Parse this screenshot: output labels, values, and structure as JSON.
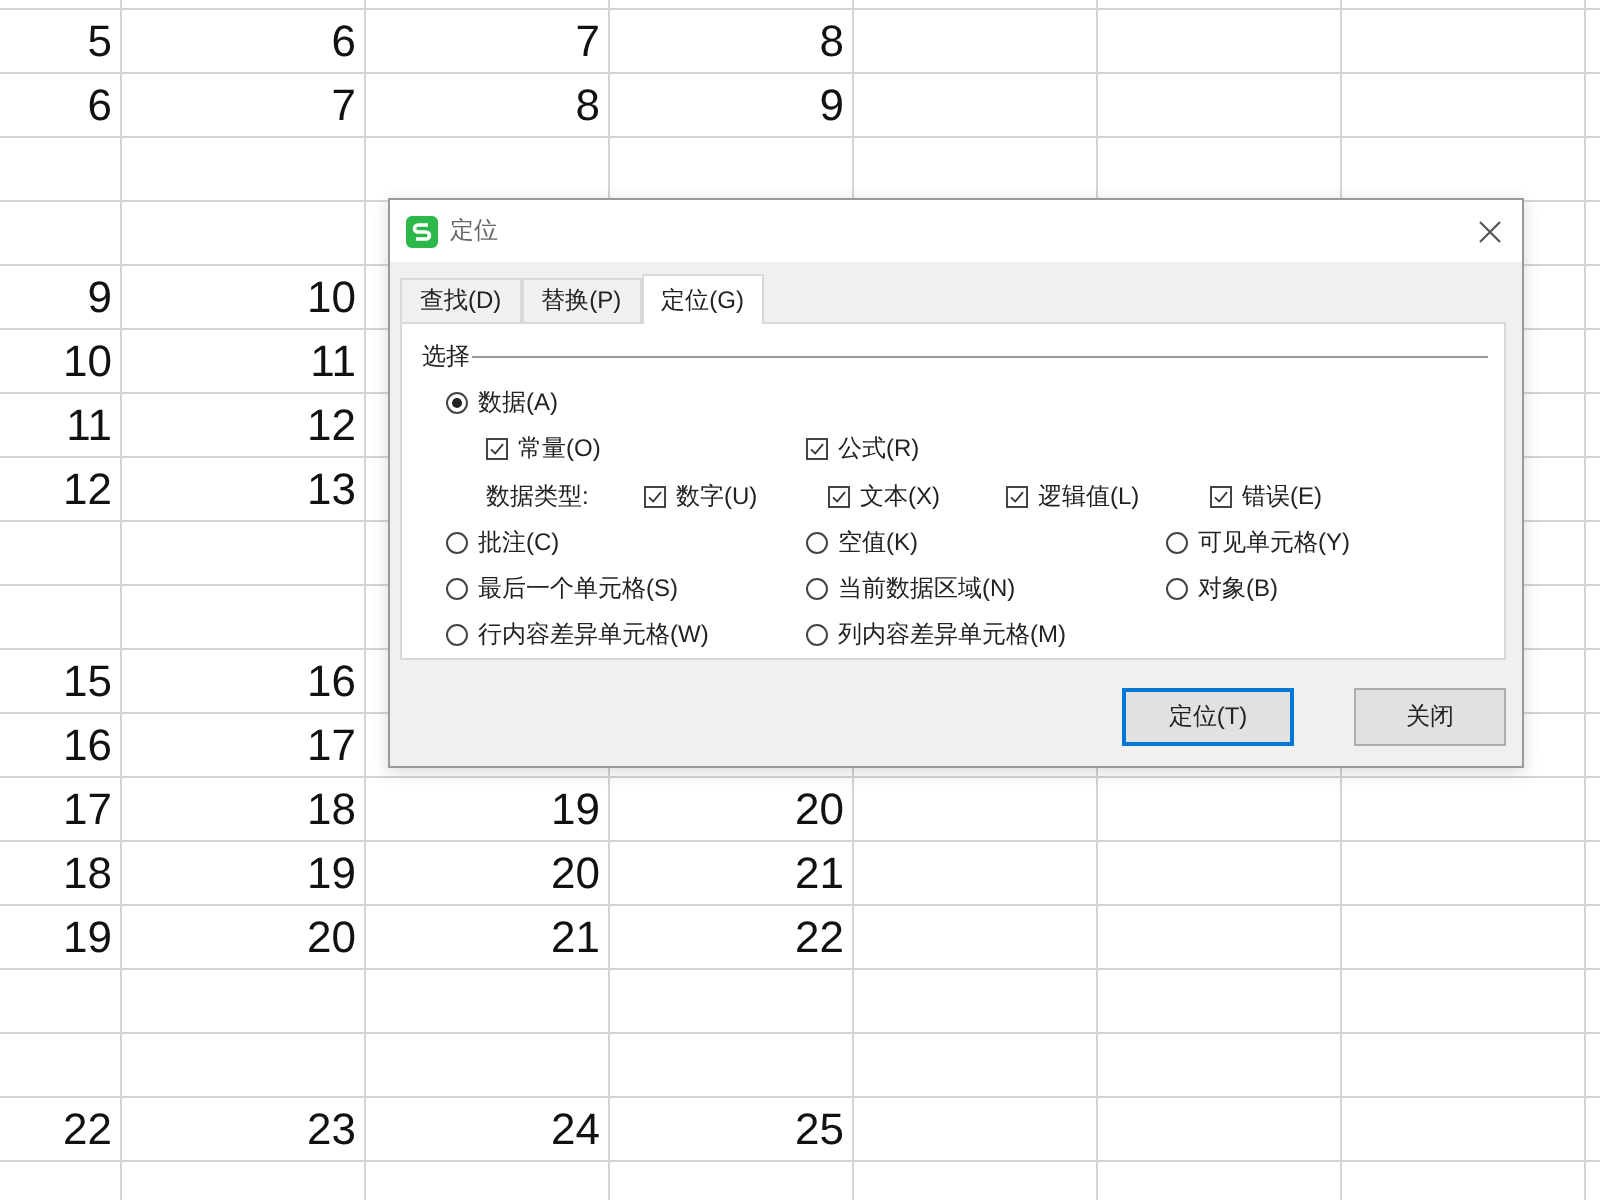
{
  "sheet": {
    "rows": [
      {
        "cells": [
          "5",
          "6",
          "7",
          "8"
        ]
      },
      {
        "cells": [
          "6",
          "7",
          "8",
          "9"
        ]
      },
      {
        "cells": []
      },
      {
        "cells": []
      },
      {
        "cells": [
          "9",
          "10"
        ]
      },
      {
        "cells": [
          "10",
          "11"
        ]
      },
      {
        "cells": [
          "11",
          "12"
        ]
      },
      {
        "cells": [
          "12",
          "13"
        ]
      },
      {
        "cells": []
      },
      {
        "cells": []
      },
      {
        "cells": [
          "15",
          "16"
        ]
      },
      {
        "cells": [
          "16",
          "17"
        ]
      },
      {
        "cells": [
          "17",
          "18",
          "19",
          "20"
        ]
      },
      {
        "cells": [
          "18",
          "19",
          "20",
          "21"
        ]
      },
      {
        "cells": [
          "19",
          "20",
          "21",
          "22"
        ]
      },
      {
        "cells": []
      },
      {
        "cells": []
      },
      {
        "cells": [
          "22",
          "23",
          "24",
          "25"
        ]
      },
      {
        "cells": []
      }
    ]
  },
  "dialog": {
    "title": "定位",
    "tabs": [
      {
        "label": "查找(D)",
        "selected": false
      },
      {
        "label": "替换(P)",
        "selected": false
      },
      {
        "label": "定位(G)",
        "selected": true
      }
    ],
    "group_label": "选择",
    "data_option": {
      "label": "数据(A)",
      "selected": true
    },
    "data_checks": [
      {
        "label": "常量(O)",
        "checked": true
      },
      {
        "label": "公式(R)",
        "checked": true
      }
    ],
    "data_type_label": "数据类型:",
    "data_types": [
      {
        "label": "数字(U)",
        "checked": true
      },
      {
        "label": "文本(X)",
        "checked": true
      },
      {
        "label": "逻辑值(L)",
        "checked": true
      },
      {
        "label": "错误(E)",
        "checked": true
      }
    ],
    "options": [
      {
        "label": "批注(C)",
        "selected": false
      },
      {
        "label": "空值(K)",
        "selected": false
      },
      {
        "label": "可见单元格(Y)",
        "selected": false
      },
      {
        "label": "最后一个单元格(S)",
        "selected": false
      },
      {
        "label": "当前数据区域(N)",
        "selected": false
      },
      {
        "label": "对象(B)",
        "selected": false
      },
      {
        "label": "行内容差异单元格(W)",
        "selected": false
      },
      {
        "label": "列内容差异单元格(M)",
        "selected": false
      }
    ],
    "buttons": [
      {
        "label": "定位(T)",
        "default": true
      },
      {
        "label": "关闭",
        "default": false
      }
    ]
  }
}
